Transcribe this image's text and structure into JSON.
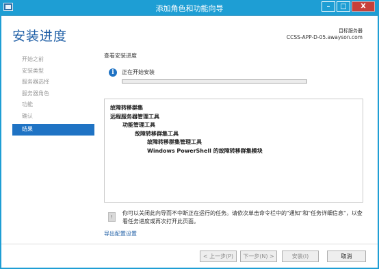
{
  "window": {
    "title": "添加角色和功能向导",
    "controls": {
      "minimize": "–",
      "maximize": "□",
      "close": "X"
    }
  },
  "header": {
    "page_title": "安装进度",
    "destination_label": "目标服务器",
    "destination_server": "CCSS-APP-D-05.awayson.com"
  },
  "sidebar": {
    "items": [
      {
        "label": "开始之前",
        "active": false
      },
      {
        "label": "安装类型",
        "active": false
      },
      {
        "label": "服务器选择",
        "active": false
      },
      {
        "label": "服务器角色",
        "active": false
      },
      {
        "label": "功能",
        "active": false
      },
      {
        "label": "确认",
        "active": false
      },
      {
        "label": "结果",
        "active": true
      }
    ]
  },
  "main": {
    "section_heading": "查看安装进度",
    "status": "正在开始安装",
    "progress_fraction": 0.0,
    "features": [
      {
        "label": "故障转移群集",
        "level": 0
      },
      {
        "label": "远程服务器管理工具",
        "level": 0
      },
      {
        "label": "功能管理工具",
        "level": 1
      },
      {
        "label": "故障转移群集工具",
        "level": 2
      },
      {
        "label": "故障转移群集管理工具",
        "level": 3
      },
      {
        "label": "Windows PowerShell 的故障转移群集模块",
        "level": 3
      }
    ],
    "note": "你可以关闭此向导而不中断正在运行的任务。请依次单击命令栏中的\"通知\"和\"任务详细信息\"，以查看任务进度或再次打开此页面。",
    "export_link": "导出配置设置"
  },
  "footer": {
    "previous": "< 上一步(P)",
    "next": "下一步(N) >",
    "install": "安装(I)",
    "cancel": "取消"
  }
}
